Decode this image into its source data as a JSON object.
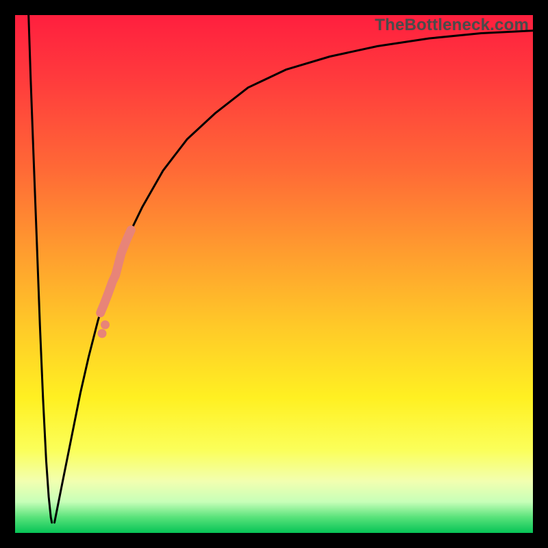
{
  "watermark": "TheBottleneck.com",
  "chart_data": {
    "type": "line",
    "title": "",
    "xlabel": "",
    "ylabel": "",
    "xlim": [
      0,
      100
    ],
    "ylim": [
      0,
      100
    ],
    "series": [
      {
        "name": "curve-left-branch",
        "x": [
          2.6,
          3.0,
          3.6,
          4.2,
          4.8,
          5.4,
          6.0,
          6.5,
          6.9,
          7.1
        ],
        "y": [
          100,
          88,
          72,
          56,
          40,
          26,
          14,
          7,
          3,
          2
        ]
      },
      {
        "name": "curve-right-branch",
        "x": [
          7.6,
          8.2,
          9.0,
          10.0,
          11.2,
          12.6,
          14.2,
          16.0,
          18.4,
          21.2,
          24.6,
          28.6,
          33.2,
          38.6,
          45.0,
          52.4,
          60.8,
          70.0,
          80.0,
          90.0,
          100.0
        ],
        "y": [
          2,
          5,
          9,
          14,
          20,
          27,
          34,
          41,
          49,
          56,
          63,
          70,
          76,
          81,
          86,
          89.5,
          92,
          94,
          95.5,
          96.5,
          97
        ]
      }
    ],
    "highlight": {
      "name": "salmon-segment",
      "x": [
        16.5,
        17.2,
        18.0,
        18.8,
        19.4,
        20.5,
        21.5,
        22.4
      ],
      "y": [
        42.5,
        44.2,
        46.3,
        48.5,
        49.8,
        54.0,
        56.5,
        58.5
      ]
    },
    "highlight_dots": {
      "name": "salmon-dots",
      "x": [
        16.8,
        17.4
      ],
      "y": [
        38.5,
        40.2
      ]
    }
  }
}
